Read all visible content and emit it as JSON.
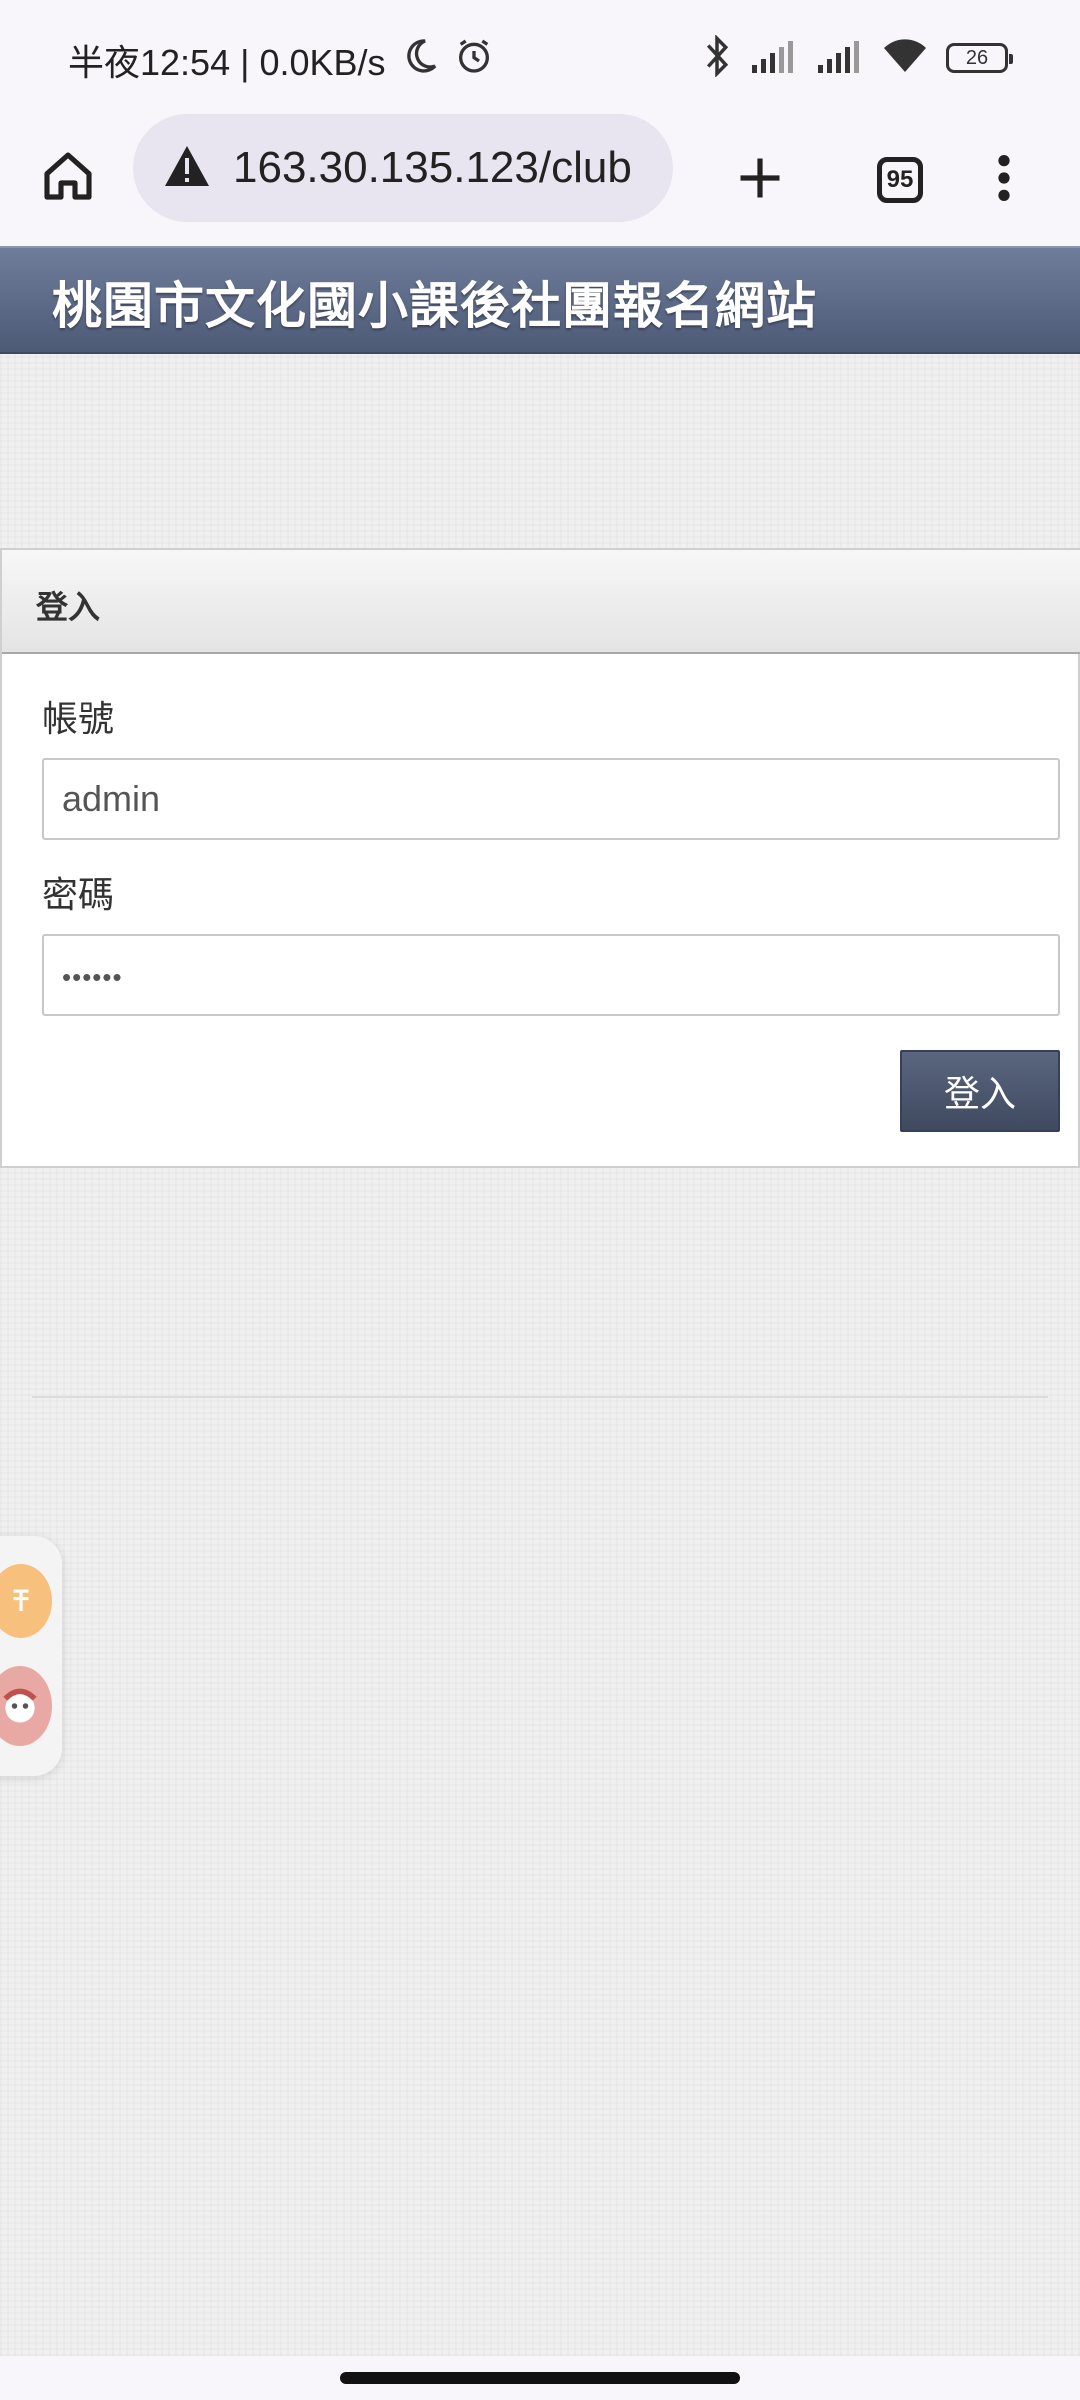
{
  "status_bar": {
    "time_text": "半夜12:54 | 0.0KB/s",
    "battery_level": "26"
  },
  "browser": {
    "url": "163.30.135.123/club",
    "tab_count": "95",
    "security_icon": "warning-triangle-icon"
  },
  "site": {
    "title": "桃園市文化國小課後社團報名網站"
  },
  "login": {
    "heading": "登入",
    "username_label": "帳號",
    "username_value": "admin",
    "password_label": "密碼",
    "password_masked": "••••••",
    "submit_label": "登入"
  },
  "colors": {
    "header": "#5b6884",
    "button": "#4a556c",
    "float_a": "#f7c07c"
  }
}
